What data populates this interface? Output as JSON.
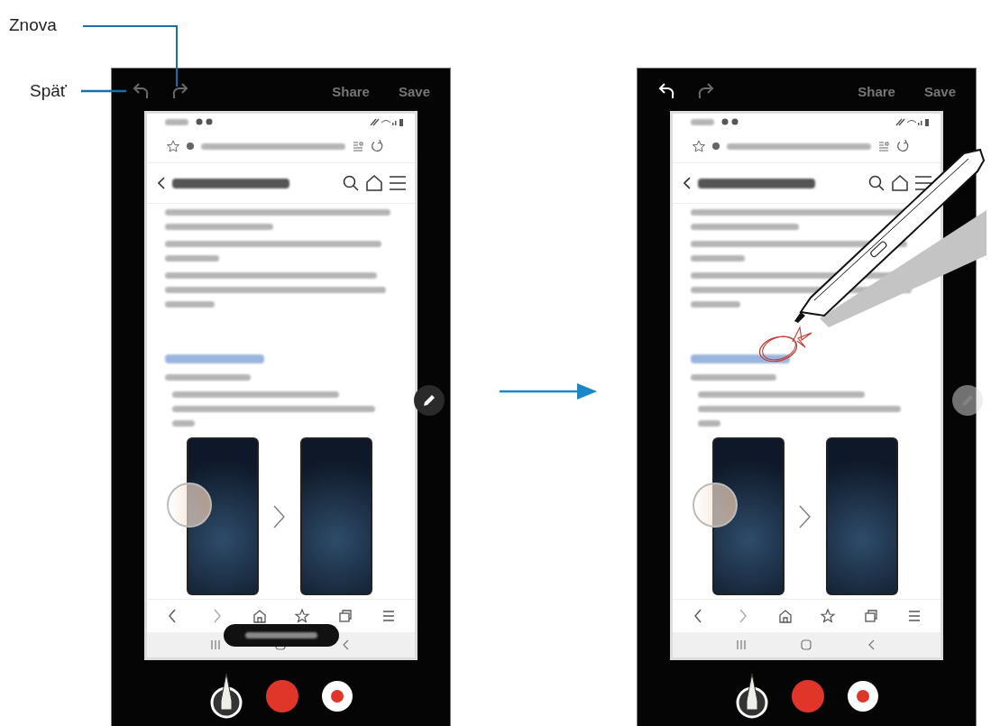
{
  "callouts": [
    {
      "label": "Znova"
    },
    {
      "label": "Späť"
    }
  ],
  "screens": [
    {
      "undo_disabled": true,
      "redo_disabled": true,
      "actions": [
        "Share",
        "Save"
      ],
      "scroll_capture_shown": true,
      "drawing_shown": false
    },
    {
      "undo_disabled": false,
      "redo_disabled": true,
      "actions": [
        "Share",
        "Save"
      ],
      "scroll_capture_shown": false,
      "drawing_shown": true
    }
  ]
}
